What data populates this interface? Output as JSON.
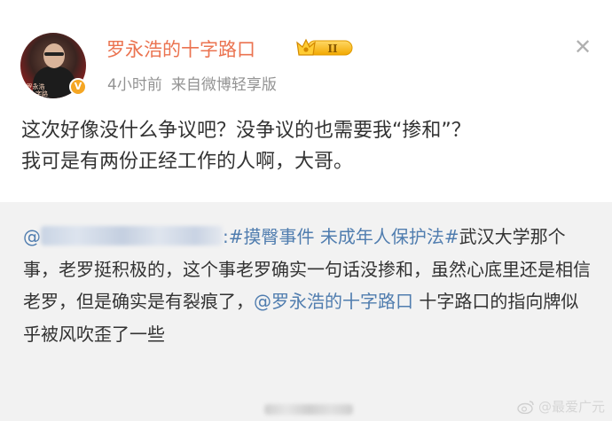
{
  "post": {
    "author": "罗永浩的十字路口",
    "vip_level": "II",
    "time": "4小时前",
    "source": "来自微博轻享版",
    "text_line1": "这次好像没什么争议吧？没争议的也需要我“掺和”？",
    "text_line2": "我可是有两份正经工作的人啊，大哥。",
    "close_glyph": "✕",
    "avatar_caption": "罗永浩 的十字路口",
    "verify_glyph": "V"
  },
  "repost": {
    "at_sign": "@",
    "colon": ":",
    "tag1": "#摸臀事件 未成年人保护法#",
    "text1": "武汉大学那个事，老罗挺积极的，这个事老罗确实一句话没掺和，虽然心底里还是相信老罗，但是确实是有裂痕了，",
    "mention": "@罗永浩的十字路口",
    "text2": " 十字路口的指向牌似乎被风吹歪了一些"
  },
  "watermark": {
    "text": "@最爱广元"
  },
  "colors": {
    "author": "#eb7350",
    "link": "#507daf",
    "meta": "#939393",
    "repost_bg": "#f2f2f2"
  }
}
